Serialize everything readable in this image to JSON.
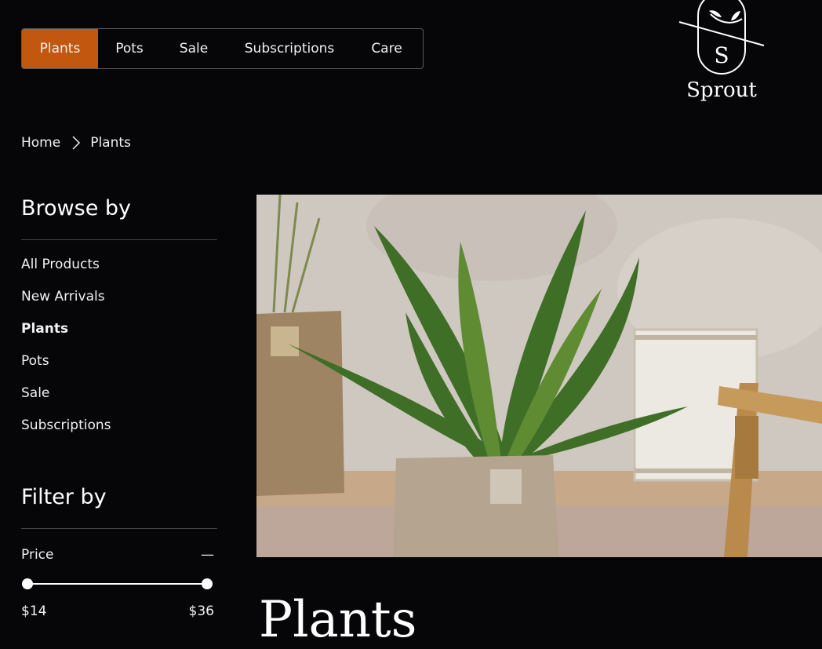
{
  "nav": {
    "items": [
      {
        "label": "Plants",
        "active": true
      },
      {
        "label": "Pots"
      },
      {
        "label": "Sale"
      },
      {
        "label": "Subscriptions"
      },
      {
        "label": "Care"
      }
    ]
  },
  "brand": {
    "name": "Sprout",
    "monogram": "S",
    "accent_color": "#c25710"
  },
  "breadcrumb": {
    "items": [
      "Home",
      "Plants"
    ]
  },
  "sidebar": {
    "browse_heading": "Browse by",
    "items": [
      {
        "label": "All Products"
      },
      {
        "label": "New Arrivals"
      },
      {
        "label": "Plants",
        "active": true
      },
      {
        "label": "Pots"
      },
      {
        "label": "Sale"
      },
      {
        "label": "Subscriptions"
      }
    ],
    "filter_heading": "Filter by",
    "price": {
      "label": "Price",
      "toggle": "—",
      "min_label": "$14",
      "max_label": "$36"
    }
  },
  "main": {
    "title": "Plants"
  }
}
